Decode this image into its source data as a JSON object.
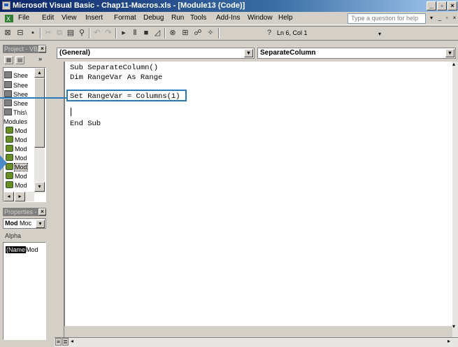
{
  "window": {
    "title": "Microsoft Visual Basic - Chap11-Macros.xls - [Module13 (Code)]",
    "caption_buttons": [
      "_",
      "▫",
      "×"
    ]
  },
  "menu": {
    "items": [
      "File",
      "Edit",
      "View",
      "Insert",
      "Format",
      "Debug",
      "Run",
      "Tools",
      "Add-Ins",
      "Window",
      "Help"
    ],
    "help_placeholder": "Type a question for help"
  },
  "toolbar": {
    "position": "Ln 6, Col 1"
  },
  "project_pane": {
    "title": "Project - VBA",
    "nodes": [
      {
        "label": "Shee",
        "kind": "sheet"
      },
      {
        "label": "Shee",
        "kind": "sheet"
      },
      {
        "label": "Shee",
        "kind": "sheet"
      },
      {
        "label": "Shee",
        "kind": "sheet"
      },
      {
        "label": "This\\",
        "kind": "workbook"
      },
      {
        "label": "Modules",
        "kind": "folder"
      },
      {
        "label": "Mod",
        "kind": "module"
      },
      {
        "label": "Mod",
        "kind": "module"
      },
      {
        "label": "Mod",
        "kind": "module"
      },
      {
        "label": "Mod",
        "kind": "module"
      },
      {
        "label": "Mod",
        "kind": "module"
      },
      {
        "label": "Mod",
        "kind": "module"
      },
      {
        "label": "Mod",
        "kind": "module"
      }
    ]
  },
  "properties_pane": {
    "title": "Properties -",
    "object": "Mod",
    "object_type": "Moc",
    "tab": "Alpha",
    "row_key": "(Name",
    "row_value": "Mod"
  },
  "code_window": {
    "object_combo": "(General)",
    "proc_combo": "SeparateColumn",
    "lines": [
      "Sub SeparateColumn()",
      "Dim RangeVar As Range",
      "",
      "Set RangeVar = Columns(1)",
      "",
      "",
      "End Sub"
    ]
  },
  "colors": {
    "highlight": "#2a7ab8",
    "titlebar": "#0a246a"
  }
}
